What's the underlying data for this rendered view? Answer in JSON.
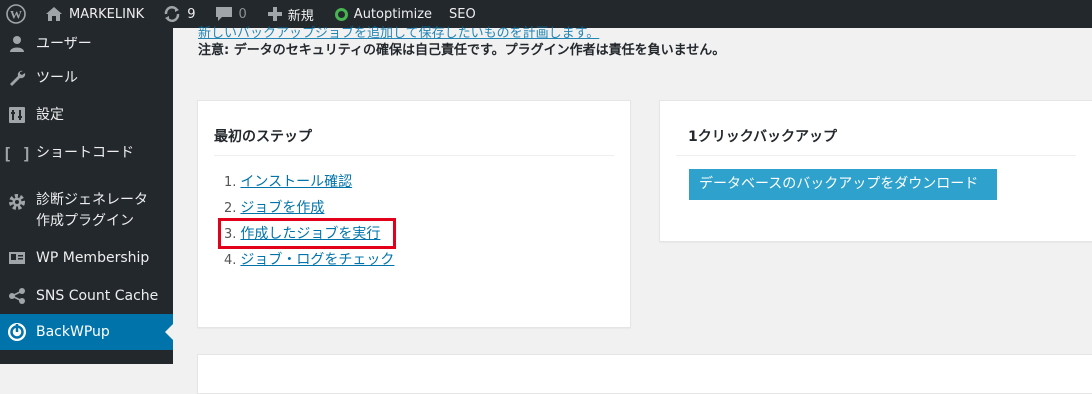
{
  "adminbar": {
    "site_name": "MARKELINK",
    "updates_count": "9",
    "comments_count": "0",
    "new_label": "新規",
    "autoptimize_label": "Autoptimize",
    "seo_label": "SEO"
  },
  "sidebar": {
    "items": [
      {
        "label": "ユーザー",
        "icon": "users-icon"
      },
      {
        "label": "ツール",
        "icon": "wrench-icon"
      },
      {
        "label": "設定",
        "icon": "settings-icon"
      },
      {
        "label": "ショートコード",
        "icon": "brackets-icon"
      },
      {
        "label": "診断ジェネレータ",
        "label2": "作成プラグイン",
        "icon": "gear-icon"
      },
      {
        "label": "WP Membership",
        "icon": "id-card-icon"
      },
      {
        "label": "SNS Count Cache",
        "icon": "share-icon"
      },
      {
        "label": "BackWPup",
        "icon": "backwpup-icon",
        "active": true
      }
    ]
  },
  "main": {
    "top_link_text": "新しいバックアップジョブを追加して保存したいものを計画します。",
    "note_text": "注意: データのセキュリティの確保は自己責任です。プラグイン作者は責任を負いません。"
  },
  "first_steps": {
    "title": "最初のステップ",
    "steps": [
      {
        "num": "1.",
        "label": "インストール確認"
      },
      {
        "num": "2.",
        "label": "ジョブを作成"
      },
      {
        "num": "3.",
        "label": "作成したジョブを実行"
      },
      {
        "num": "4.",
        "label": "ジョブ・ログをチェック"
      }
    ]
  },
  "one_click_backup": {
    "title": "1クリックバックアップ",
    "button_label": "データベースのバックアップをダウンロード"
  },
  "colors": {
    "adminbar_bg": "#23282d",
    "active_menu": "#0073aa",
    "link": "#0073aa",
    "button": "#2ea2cc",
    "highlight_border": "#e3001b"
  }
}
